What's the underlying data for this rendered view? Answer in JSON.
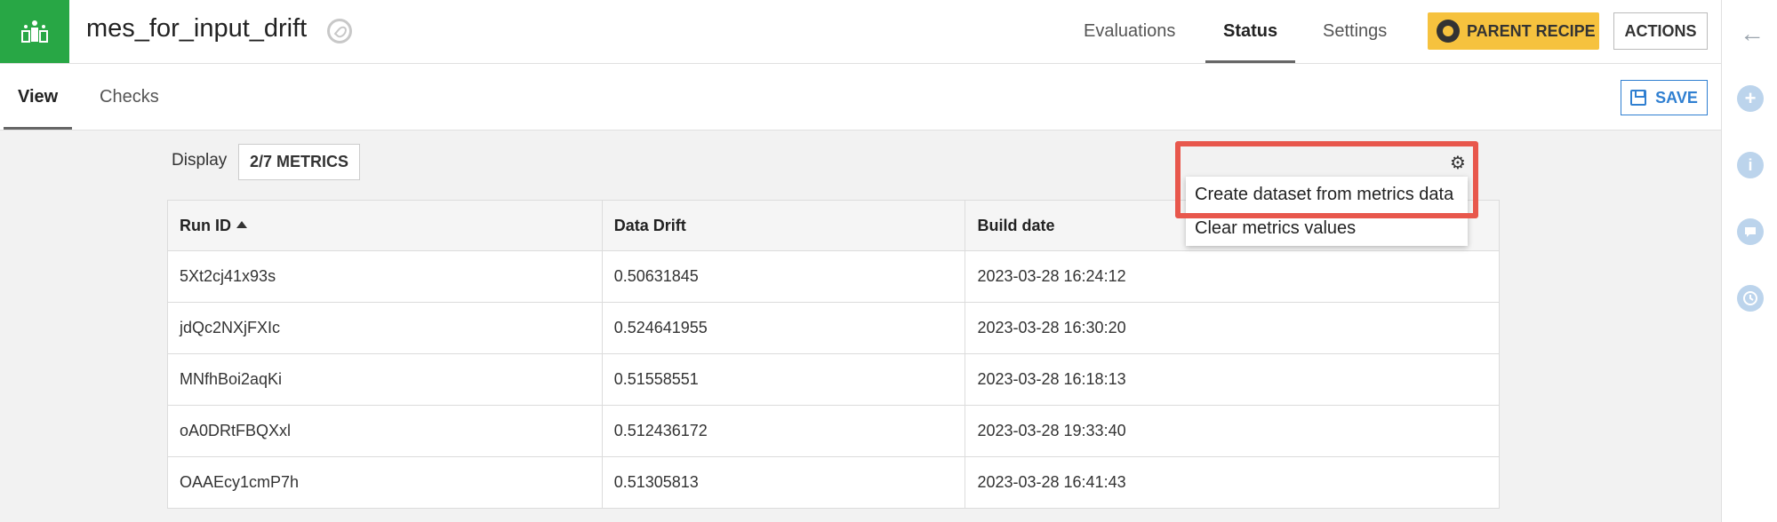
{
  "header": {
    "title": "mes_for_input_drift",
    "nav": [
      "Evaluations",
      "Status",
      "Settings"
    ],
    "active_nav": "Status",
    "parent_recipe_label": "PARENT RECIPE",
    "actions_label": "ACTIONS"
  },
  "subnav": {
    "tabs": [
      "View",
      "Checks"
    ],
    "active_tab": "View",
    "save_label": "SAVE"
  },
  "display": {
    "label": "Display",
    "metrics_button": "2/7 METRICS"
  },
  "table": {
    "columns": [
      "Run ID",
      "Data Drift",
      "Build date"
    ],
    "rows": [
      [
        "5Xt2cj41x93s",
        "0.50631845",
        "2023-03-28 16:24:12"
      ],
      [
        "jdQc2NXjFXIc",
        "0.524641955",
        "2023-03-28 16:30:20"
      ],
      [
        "MNfhBoi2aqKi",
        "0.51558551",
        "2023-03-28 16:18:13"
      ],
      [
        "oA0DRtFBQXxl",
        "0.512436172",
        "2023-03-28 19:33:40"
      ],
      [
        "OAAEcy1cmP7h",
        "0.51305813",
        "2023-03-28 16:41:43"
      ]
    ]
  },
  "menu": {
    "items": [
      "Create dataset from metrics data",
      "Clear metrics values"
    ]
  },
  "colors": {
    "app_green": "#28a745",
    "parent_recipe_yellow": "#f6c23e",
    "save_blue": "#2f7fd1",
    "highlight_red": "#e8574c"
  },
  "icons": {
    "app": "metrics-app-icon",
    "settings": "gear-icon",
    "save": "floppy-icon",
    "sidebar": [
      "back-arrow-icon",
      "plus-icon",
      "info-icon",
      "chat-icon",
      "clock-icon"
    ]
  }
}
